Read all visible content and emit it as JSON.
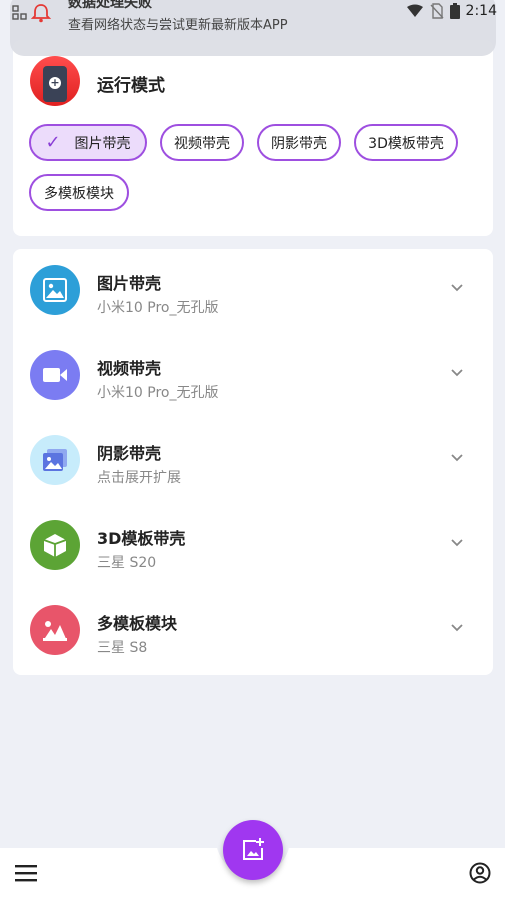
{
  "status_bar": {
    "time": "2:14",
    "icons": [
      "notification-icon",
      "wifi-icon",
      "no-sim-icon",
      "battery-icon"
    ]
  },
  "notification": {
    "title": "数据处理失败",
    "body": "查看网络状态与尝试更新最新版本APP"
  },
  "run_mode": {
    "title": "运行模式",
    "options": [
      {
        "label": "图片带壳",
        "selected": true
      },
      {
        "label": "视频带壳",
        "selected": false
      },
      {
        "label": "阴影带壳",
        "selected": false
      },
      {
        "label": "3D模板带壳",
        "selected": false
      },
      {
        "label": "多模板模块",
        "selected": false
      }
    ]
  },
  "templates": [
    {
      "title": "图片带壳",
      "subtitle": "小米10 Pro_无孔版",
      "icon": "image-icon",
      "color": "#2d9fd8"
    },
    {
      "title": "视频带壳",
      "subtitle": "小米10 Pro_无孔版",
      "icon": "video-icon",
      "color": "#7b7cf2"
    },
    {
      "title": "阴影带壳",
      "subtitle": "点击展开扩展",
      "icon": "shadow-image-icon",
      "color": "#c7ecfb"
    },
    {
      "title": "3D模板带壳",
      "subtitle": "三星 S20",
      "icon": "cube-icon",
      "color": "#5ca435"
    },
    {
      "title": "多模板模块",
      "subtitle": "三星 S8",
      "icon": "multi-template-icon",
      "color": "#e8556a"
    }
  ],
  "colors": {
    "accent": "#a037f0",
    "chip_border": "#9e4fe0",
    "chip_selected_bg": "#ecdcfb",
    "background": "#eef0f6"
  },
  "bottom_bar": {
    "left_icon": "menu-icon",
    "right_icon": "account-icon",
    "fab_icon": "add-image-icon"
  }
}
